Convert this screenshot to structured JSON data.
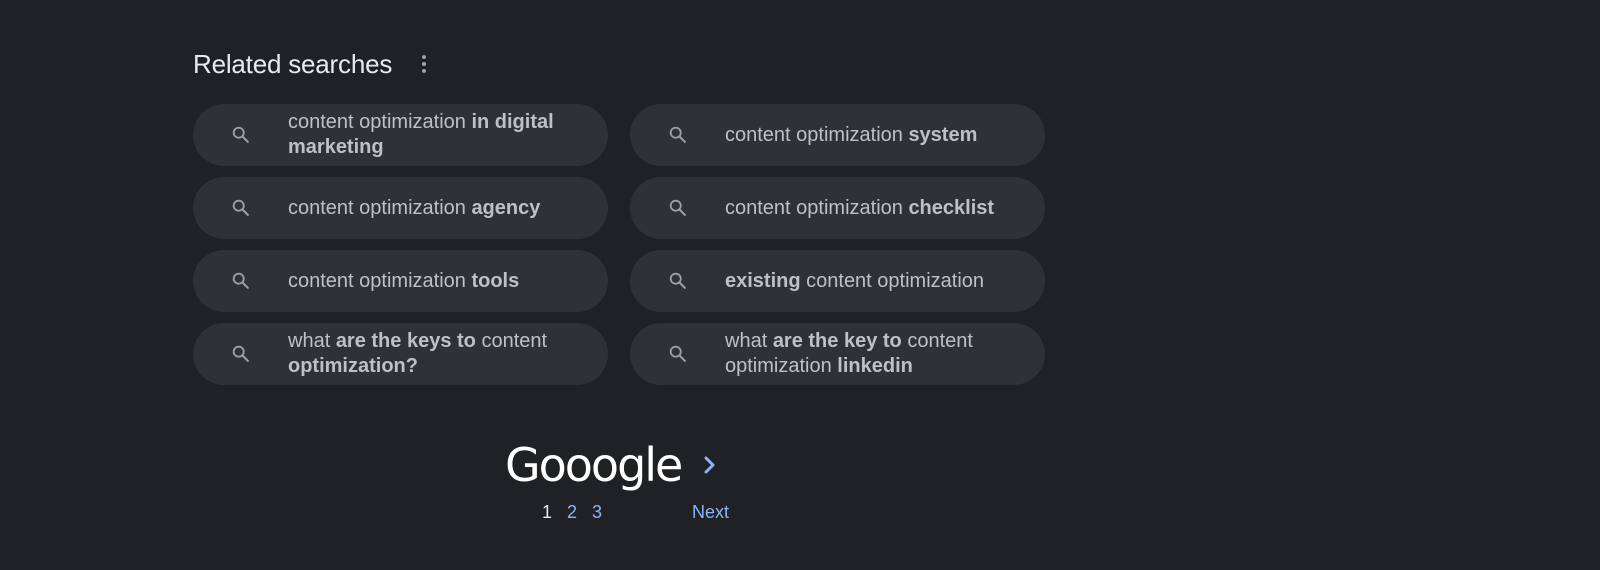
{
  "related": {
    "title": "Related searches",
    "menu_icon": "more-vert-icon",
    "search_icon": "search-icon",
    "items": [
      {
        "parts": [
          {
            "t": "content optimization ",
            "b": false
          },
          {
            "t": "in digital marketing",
            "b": true
          }
        ]
      },
      {
        "parts": [
          {
            "t": "content optimization ",
            "b": false
          },
          {
            "t": "system",
            "b": true
          }
        ]
      },
      {
        "parts": [
          {
            "t": "content optimization ",
            "b": false
          },
          {
            "t": "agency",
            "b": true
          }
        ]
      },
      {
        "parts": [
          {
            "t": "content optimization ",
            "b": false
          },
          {
            "t": "checklist",
            "b": true
          }
        ]
      },
      {
        "parts": [
          {
            "t": "content optimization ",
            "b": false
          },
          {
            "t": "tools",
            "b": true
          }
        ]
      },
      {
        "parts": [
          {
            "t": "existing",
            "b": true
          },
          {
            "t": " content optimization",
            "b": false
          }
        ]
      },
      {
        "parts": [
          {
            "t": "what ",
            "b": false
          },
          {
            "t": "are the keys to",
            "b": true
          },
          {
            "t": " content ",
            "b": false
          },
          {
            "t": "optimization?",
            "b": true
          }
        ]
      },
      {
        "parts": [
          {
            "t": "what ",
            "b": false
          },
          {
            "t": "are the key to",
            "b": true
          },
          {
            "t": " content optimization ",
            "b": false
          },
          {
            "t": "linkedin",
            "b": true
          }
        ]
      }
    ]
  },
  "pagination": {
    "logo_text": "Gooogle",
    "pages": [
      "1",
      "2",
      "3"
    ],
    "current_page": "1",
    "next_label": "Next",
    "next_icon": "chevron-right-icon"
  },
  "colors": {
    "background": "#202124",
    "chip": "#303134",
    "text": "#bdc1c6",
    "link": "#8ab4f8"
  }
}
